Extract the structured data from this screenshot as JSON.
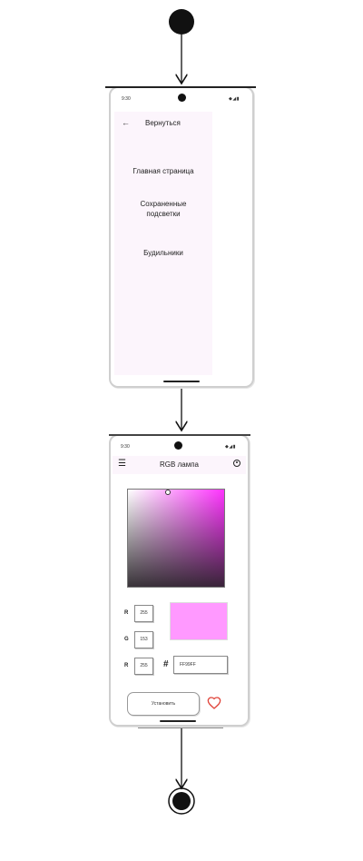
{
  "screen_menu": {
    "status_time": "9:30",
    "status_icons": "◆◢▮",
    "back_icon": "arrow-left-icon",
    "back_label": "Вернуться",
    "items": [
      {
        "label": "Главная страница"
      },
      {
        "label": "Сохраненные подсветки"
      },
      {
        "label": "Будильники"
      }
    ]
  },
  "screen_color": {
    "status_time": "9:30",
    "status_icons": "◆◢▮",
    "menu_icon": "hamburger-menu-icon",
    "title": "RGB лампа",
    "account_icon": "account-circle-icon",
    "channels": [
      {
        "label": "R",
        "value": "255"
      },
      {
        "label": "G",
        "value": "153"
      },
      {
        "label": "R",
        "value": "255"
      }
    ],
    "hash_symbol": "#",
    "hex_value": "FF99FF",
    "preview_color": "#ff99ff",
    "set_label": "Установить",
    "favorite_icon": "heart-icon",
    "favorite_color": "#e0453b"
  },
  "colors": {
    "drawer_bg": "#fcf5fc",
    "palette_hue": "#ff33ff"
  }
}
